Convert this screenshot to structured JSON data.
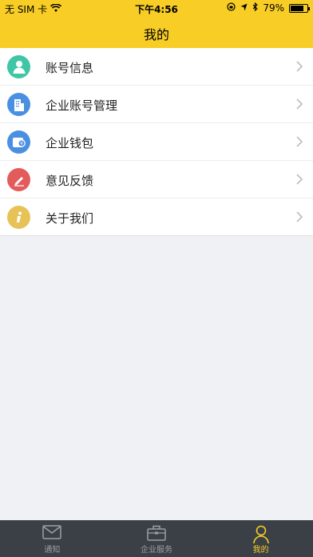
{
  "status_bar": {
    "carrier": "无 SIM 卡",
    "time": "下午4:56",
    "battery": "79%",
    "battery_level": 0.79
  },
  "nav": {
    "title": "我的"
  },
  "menu": [
    {
      "label": "账号信息",
      "icon": "user-icon",
      "color": "#3ec6a7"
    },
    {
      "label": "企业账号管理",
      "icon": "building-icon",
      "color": "#4a90e2"
    },
    {
      "label": "企业钱包",
      "icon": "wallet-icon",
      "color": "#4a90e2"
    },
    {
      "label": "意见反馈",
      "icon": "pencil-icon",
      "color": "#e35b5b"
    },
    {
      "label": "关于我们",
      "icon": "info-icon",
      "color": "#e7c357"
    }
  ],
  "tabs": [
    {
      "label": "通知",
      "icon": "mail-icon",
      "active": false
    },
    {
      "label": "企业服务",
      "icon": "briefcase-icon",
      "active": false
    },
    {
      "label": "我的",
      "icon": "person-icon",
      "active": true
    }
  ],
  "colors": {
    "accent": "#f7cd26",
    "tabbar": "#3b3f46"
  }
}
